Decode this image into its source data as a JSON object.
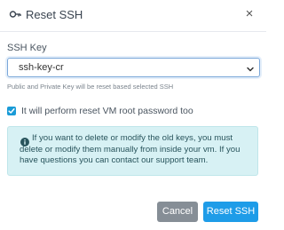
{
  "dialog": {
    "title": "Reset SSH",
    "title_icon": "key-icon",
    "close_glyph": "×"
  },
  "form": {
    "ssh_key_label": "SSH Key",
    "ssh_key_selected": "ssh-key-cr",
    "helper_text": "Public and Private Key will be reset based selected SSH",
    "reset_password_checked": true,
    "reset_password_label": "It will perform reset VM root password too"
  },
  "alert": {
    "icon": "info-icon",
    "text": "If you want to delete or modify the old keys, you must delete or modify them manually from inside your vm. If you have questions you can contact our support team."
  },
  "footer": {
    "cancel_label": "Cancel",
    "reset_label": "Reset SSH"
  },
  "colors": {
    "primary": "#1e9ce8",
    "secondary": "#868e96",
    "alert_bg": "#d7f1f4",
    "checkbox": "#1a9bd7"
  }
}
